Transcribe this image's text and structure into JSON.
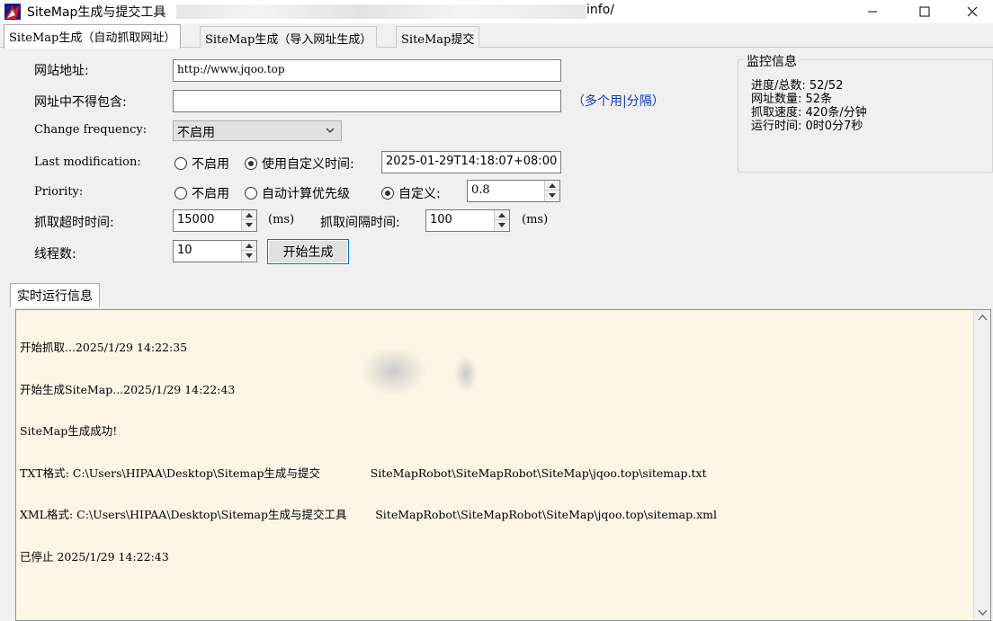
{
  "window": {
    "title": "SiteMap生成与提交工具",
    "title_suffix": "info/"
  },
  "tabs": [
    {
      "label": "SiteMap生成（自动抓取网址）",
      "active": true
    },
    {
      "label": "SiteMap生成（导入网址生成）",
      "active": false
    },
    {
      "label": "SiteMap提交",
      "active": false
    }
  ],
  "form": {
    "site_url_label": "网站地址:",
    "site_url_value": "http://www.jqoo.top",
    "exclude_label": "网址中不得包含:",
    "exclude_value": "",
    "exclude_hint": "（多个用|分隔）",
    "changefreq_label": "Change frequency:",
    "changefreq_value": "不启用",
    "lastmod_label": "Last modification:",
    "lastmod_opt_off": "不启用",
    "lastmod_opt_custom": "使用自定义时间:",
    "lastmod_value": "2025-01-29T14:18:07+08:00",
    "priority_label": "Priority:",
    "priority_opt_off": "不启用",
    "priority_opt_auto": "自动计算优先级",
    "priority_opt_custom": "自定义:",
    "priority_value": "0.8",
    "timeout_label": "抓取超时时间:",
    "timeout_value": "15000",
    "timeout_unit": "(ms)",
    "interval_label": "抓取间隔时间:",
    "interval_value": "100",
    "interval_unit": "(ms)",
    "threads_label": "线程数:",
    "threads_value": "10",
    "start_button": "开始生成"
  },
  "monitor": {
    "title": "监控信息",
    "progress": "进度/总数: 52/52",
    "url_count": "网址数量:  52条",
    "speed": "抓取速度:  420条/分钟",
    "runtime": "运行时间:  0时0分7秒"
  },
  "log": {
    "tab_label": "实时运行信息",
    "lines": [
      "开始抓取...2025/1/29 14:22:35",
      "开始生成SiteMap...2025/1/29 14:22:43",
      "SiteMap生成成功!",
      "TXT格式: C:\\Users\\HIPAA\\Desktop\\Sitemap生成与提交              SiteMapRobot\\SiteMapRobot\\SiteMap\\jqoo.top\\sitemap.txt",
      "XML格式: C:\\Users\\HIPAA\\Desktop\\Sitemap生成与提交工具        SiteMapRobot\\SiteMapRobot\\SiteMap\\jqoo.top\\sitemap.xml",
      "已停止 2025/1/29 14:22:43"
    ]
  }
}
